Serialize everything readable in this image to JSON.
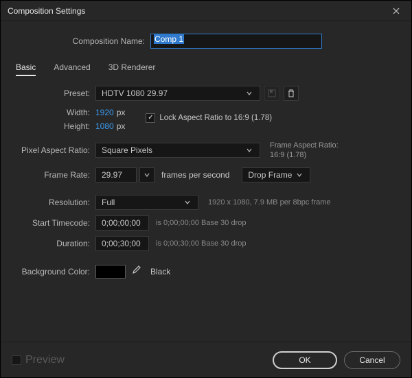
{
  "titlebar": {
    "title": "Composition Settings"
  },
  "name": {
    "label": "Composition Name:",
    "value": "Comp 1"
  },
  "tabs": {
    "basic": "Basic",
    "advanced": "Advanced",
    "renderer": "3D Renderer"
  },
  "preset": {
    "label": "Preset:",
    "value": "HDTV 1080 29.97"
  },
  "width": {
    "label": "Width:",
    "value": "1920",
    "unit": "px"
  },
  "height": {
    "label": "Height:",
    "value": "1080",
    "unit": "px"
  },
  "lock": {
    "label": "Lock Aspect Ratio to 16:9 (1.78)"
  },
  "par": {
    "label": "Pixel Aspect Ratio:",
    "value": "Square Pixels",
    "frame_label": "Frame Aspect Ratio:",
    "frame_value": "16:9 (1.78)"
  },
  "fps": {
    "label": "Frame Rate:",
    "value": "29.97",
    "unit": "frames per second",
    "drop": "Drop Frame"
  },
  "res": {
    "label": "Resolution:",
    "value": "Full",
    "info": "1920 x 1080, 7.9 MB per 8bpc frame"
  },
  "start": {
    "label": "Start Timecode:",
    "value": "0;00;00;00",
    "info": "is 0;00;00;00  Base 30  drop"
  },
  "dur": {
    "label": "Duration:",
    "value": "0;00;30;00",
    "info": "is 0;00;30;00  Base 30  drop"
  },
  "bg": {
    "label": "Background Color:",
    "name": "Black"
  },
  "footer": {
    "preview": "Preview",
    "ok": "OK",
    "cancel": "Cancel"
  }
}
